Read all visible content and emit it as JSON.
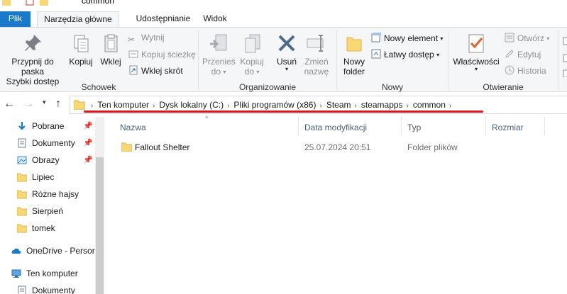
{
  "window": {
    "title": "common"
  },
  "tabs": [
    {
      "label": "Plik"
    },
    {
      "label": "Narzędzia główne"
    },
    {
      "label": "Udostępnianie"
    },
    {
      "label": "Widok"
    }
  ],
  "ribbon": {
    "clipboard": {
      "pin_line1": "Przypnij do paska",
      "pin_line2": "Szybki dostęp",
      "copy": "Kopiuj",
      "paste": "Wklej",
      "cut": "Wytnij",
      "copy_path": "Kopiuj ścieżkę",
      "paste_shortcut": "Wklej skrót",
      "group": "Schowek"
    },
    "organize": {
      "move_line1": "Przenieś",
      "move_line2": "do",
      "copy_line1": "Kopiuj",
      "copy_line2": "do",
      "delete": "Usuń",
      "rename_line1": "Zmień",
      "rename_line2": "nazwę",
      "group": "Organizowanie"
    },
    "new": {
      "folder_line1": "Nowy",
      "folder_line2": "folder",
      "new_item": "Nowy element",
      "easy_access": "Łatwy dostęp",
      "group": "Nowy"
    },
    "open": {
      "properties": "Właściwości",
      "open": "Otwórz",
      "edit": "Edytuj",
      "history": "Historia",
      "group": "Otwieranie"
    }
  },
  "address": {
    "crumbs": [
      "Ten komputer",
      "Dysk lokalny (C:)",
      "Pliki programów (x86)",
      "Steam",
      "steamapps",
      "common"
    ]
  },
  "nav_pane": {
    "items": [
      "Pobrane",
      "Dokumenty",
      "Obrazy",
      "Lipiec",
      "Różne hajsy",
      "Sierpień",
      "tomek",
      "OneDrive - Persor",
      "Ten komputer",
      "Dokumenty"
    ]
  },
  "columns": {
    "name": "Nazwa",
    "date": "Data modyfikacji",
    "type": "Typ",
    "size": "Rozmiar"
  },
  "files": [
    {
      "name": "Fallout Shelter",
      "date": "25.07.2024 20:51",
      "type": "Folder plików"
    }
  ],
  "colors": {
    "file_tab": "#1979ca",
    "folder": "#f8d775",
    "annotation": "#e0141e",
    "header_text": "#4c607a"
  }
}
